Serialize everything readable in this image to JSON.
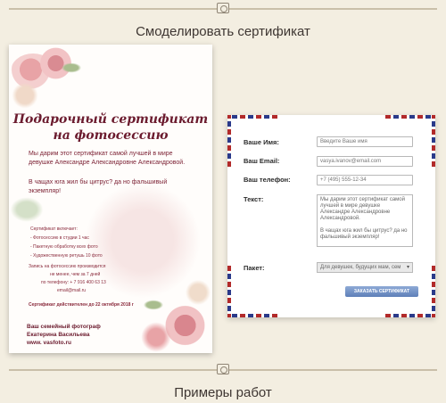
{
  "sections": {
    "model_title": "Смоделировать сертификат",
    "examples_title": "Примеры работ"
  },
  "certificate": {
    "title_line1": "Подарочный сертификат",
    "title_line2": "на фотосессию",
    "message_line1": "Мы дарим этот сертификат самой лучшей в мире",
    "message_line2": "девушке Александре Александровне Александровой.",
    "message_line3": "В чащах юга жил бы цитрус? да но фальшивый",
    "message_line4": "экземпляр!",
    "includes_label": "Сертификат включает:",
    "include_1": "- Фотосессию в студии 1 час",
    "include_2": "- Пакетную обработку всех фото",
    "include_3": "- Художественную ретушь 10 фото",
    "booking_1": "Запись на фотосессию производится",
    "booking_2": "не менее, чем за 7 дней",
    "booking_3": "по телефону: + 7 916 400 63 13",
    "booking_4": "email@mail.ru",
    "valid_until": "Сертификат действителен до 22 октября 2018 г",
    "sign_1": "Ваш семейный фотограф",
    "sign_2": "Екатерина Васильева",
    "sign_3": "www. vasfoto.ru"
  },
  "form": {
    "name_label": "Ваше Имя:",
    "name_placeholder": "Введите Ваше имя",
    "email_label": "Ваш Email:",
    "email_value": "vasya.ivanov@email.com",
    "phone_label": "Ваш телефон:",
    "phone_value": "+7 (495) 555-12-34",
    "text_label": "Текст:",
    "text_value": "Мы дарим этот сертификат самой лучшей в мире девушке Александре Александровне Александровой.\n\nВ чащах юга жил бы цитрус? да но фальшивый экземпляр!",
    "package_label": "Пакет:",
    "package_value": "Для девушек, будущих мам, сем",
    "submit_label": "ЗАКАЗАТЬ СЕРТИФИКАТ"
  },
  "icons": {
    "divider": "camera-icon",
    "select_arrow": "chevron-down-icon"
  }
}
